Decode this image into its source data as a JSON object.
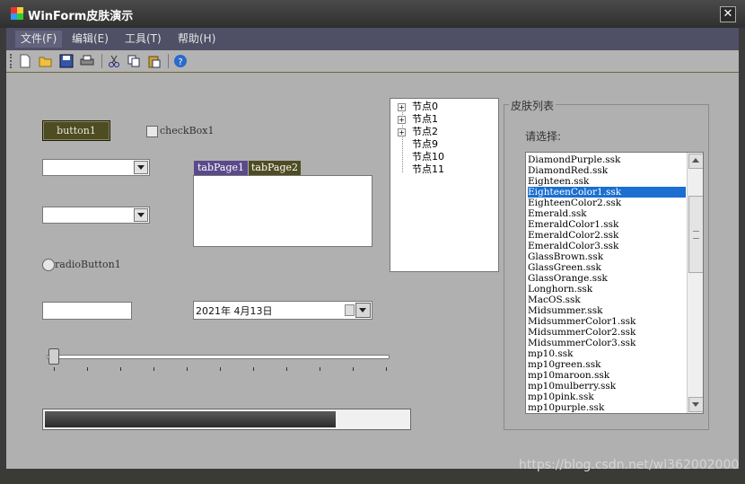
{
  "window": {
    "title": "WinForm皮肤演示"
  },
  "menu": {
    "items": [
      "文件(F)",
      "编辑(E)",
      "工具(T)",
      "帮助(H)"
    ]
  },
  "toolbar": {
    "icons": [
      "new-icon",
      "open-icon",
      "save-icon",
      "print-icon",
      "cut-icon",
      "copy-icon",
      "paste-icon",
      "help-icon"
    ]
  },
  "controls": {
    "button1": "button1",
    "checkbox1": "checkBox1",
    "radio1": "radioButton1",
    "tab1": "tabPage1",
    "tab2": "tabPage2",
    "date": "2021年  4月13日",
    "progress_percent": 80,
    "trackbar_value": 0
  },
  "tree": {
    "nodes": [
      "节点0",
      "节点1",
      "节点2",
      "节点9",
      "节点10",
      "节点11"
    ]
  },
  "skin_group": {
    "title": "皮肤列表",
    "label": "请选择:",
    "selected": "EighteenColor1.ssk",
    "items": [
      "DiamondPurple.ssk",
      "DiamondRed.ssk",
      "Eighteen.ssk",
      "EighteenColor1.ssk",
      "EighteenColor2.ssk",
      "Emerald.ssk",
      "EmeraldColor1.ssk",
      "EmeraldColor2.ssk",
      "EmeraldColor3.ssk",
      "GlassBrown.ssk",
      "GlassGreen.ssk",
      "GlassOrange.ssk",
      "Longhorn.ssk",
      "MacOS.ssk",
      "Midsummer.ssk",
      "MidsummerColor1.ssk",
      "MidsummerColor2.ssk",
      "MidsummerColor3.ssk",
      "mp10.ssk",
      "mp10green.ssk",
      "mp10maroon.ssk",
      "mp10mulberry.ssk",
      "mp10pink.ssk",
      "mp10purple.ssk"
    ]
  },
  "watermark": "https://blog.csdn.net/wl362002000"
}
